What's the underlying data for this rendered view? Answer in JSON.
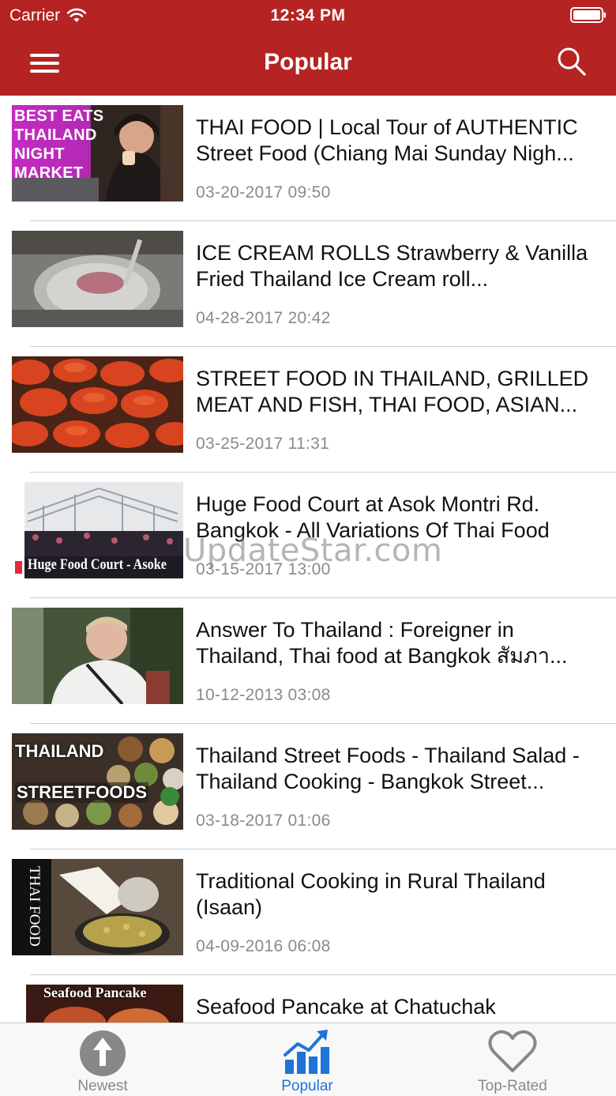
{
  "status_bar": {
    "carrier": "Carrier",
    "time": "12:34 PM"
  },
  "navbar": {
    "title": "Popular"
  },
  "videos": [
    {
      "title": "THAI FOOD | Local Tour of AUTHENTIC Street Food (Chiang Mai Sunday Nigh...",
      "date": "03-20-2017 09:50",
      "thumb_text": [
        "BEST EATS",
        "THAILAND",
        "NIGHT",
        "MARKET"
      ]
    },
    {
      "title": "ICE CREAM ROLLS   Strawberry & Vanilla   Fried Thailand Ice Cream roll...",
      "date": "04-28-2017 20:42"
    },
    {
      "title": "STREET FOOD IN THAILAND, GRILLED MEAT AND FISH, THAI FOOD, ASIAN...",
      "date": "03-25-2017 11:31"
    },
    {
      "title": "Huge Food Court at Asok Montri Rd. Bangkok - All Variations Of Thai Food",
      "date": "03-15-2017 13:00",
      "thumb_text": [
        "Huge Food Court - Asoke"
      ]
    },
    {
      "title": "Answer To Thailand : Foreigner in Thailand, Thai food at Bangkok สัมภา...",
      "date": "10-12-2013 03:08"
    },
    {
      "title": "Thailand Street Foods - Thailand Salad - Thailand Cooking - Bangkok Street...",
      "date": "03-18-2017 01:06",
      "thumb_text": [
        "THAILAND",
        "STREETFOODS"
      ]
    },
    {
      "title": "Traditional Cooking in Rural Thailand (Isaan)",
      "date": "04-09-2016 06:08",
      "thumb_text": [
        "THAI FOOD"
      ]
    },
    {
      "title": "Seafood Pancake at Chatuchak",
      "date": "",
      "thumb_text": [
        "Seafood Pancake"
      ]
    }
  ],
  "watermark": "UpdateStar.com",
  "tabs": [
    {
      "label": "Newest",
      "icon": "arrow-up-circle-icon",
      "active": false
    },
    {
      "label": "Popular",
      "icon": "bar-chart-trend-icon",
      "active": true
    },
    {
      "label": "Top-Rated",
      "icon": "heart-icon",
      "active": false
    }
  ],
  "colors": {
    "header": "#b52423",
    "tab_active": "#1f73d9",
    "tab_inactive": "#888888"
  }
}
